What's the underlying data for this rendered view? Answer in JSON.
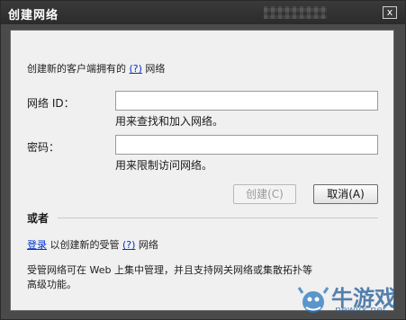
{
  "window": {
    "title": "创建网络",
    "close_glyph": "x"
  },
  "intro": {
    "prefix": "创建新的客户端拥有的",
    "help_link": "(?)",
    "suffix": "网络"
  },
  "network_id": {
    "label": "网络 ID：",
    "value": "",
    "hint": "用来查找和加入网络。"
  },
  "password": {
    "label": "密码：",
    "value": "",
    "hint": "用来限制访问网络。"
  },
  "buttons": {
    "create": "创建(C)",
    "cancel": "取消(A)"
  },
  "or_section": {
    "heading": "或者",
    "login_link": "登录",
    "text_mid": "以创建新的受管",
    "help_link": "(?)",
    "text_suffix": "网络",
    "description_line1": "受管网络可在 Web 上集中管理，并且支持网关网络或集散拓扑等",
    "description_line2": "高级功能。"
  },
  "watermark": {
    "text": "牛游戏",
    "url": "newyx.net"
  }
}
